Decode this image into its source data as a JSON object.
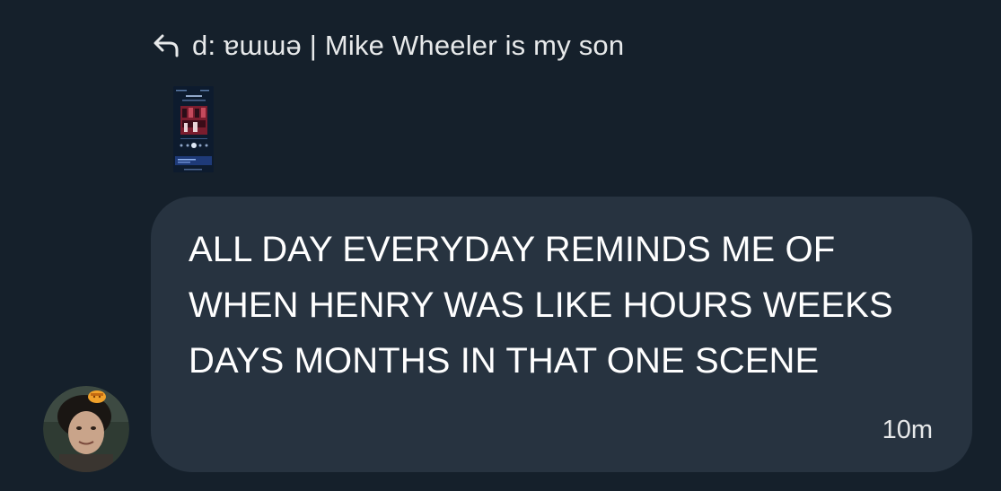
{
  "reply": {
    "icon": "reply-arrow-icon",
    "text": "d: ɐɯɯǝ | Mike Wheeler is my son"
  },
  "attachment": {
    "icon": "image-thumbnail-icon"
  },
  "message": {
    "text": "ALL DAY EVERYDAY REMINDS ME OF WHEN HENRY WAS LIKE HOURS WEEKS DAYS MONTHS IN THAT ONE SCENE",
    "time": "10m"
  },
  "avatar": {
    "icon": "user-avatar-icon"
  },
  "colors": {
    "background": "#15202b",
    "bubble": "#273340",
    "text": "#ffffff"
  }
}
